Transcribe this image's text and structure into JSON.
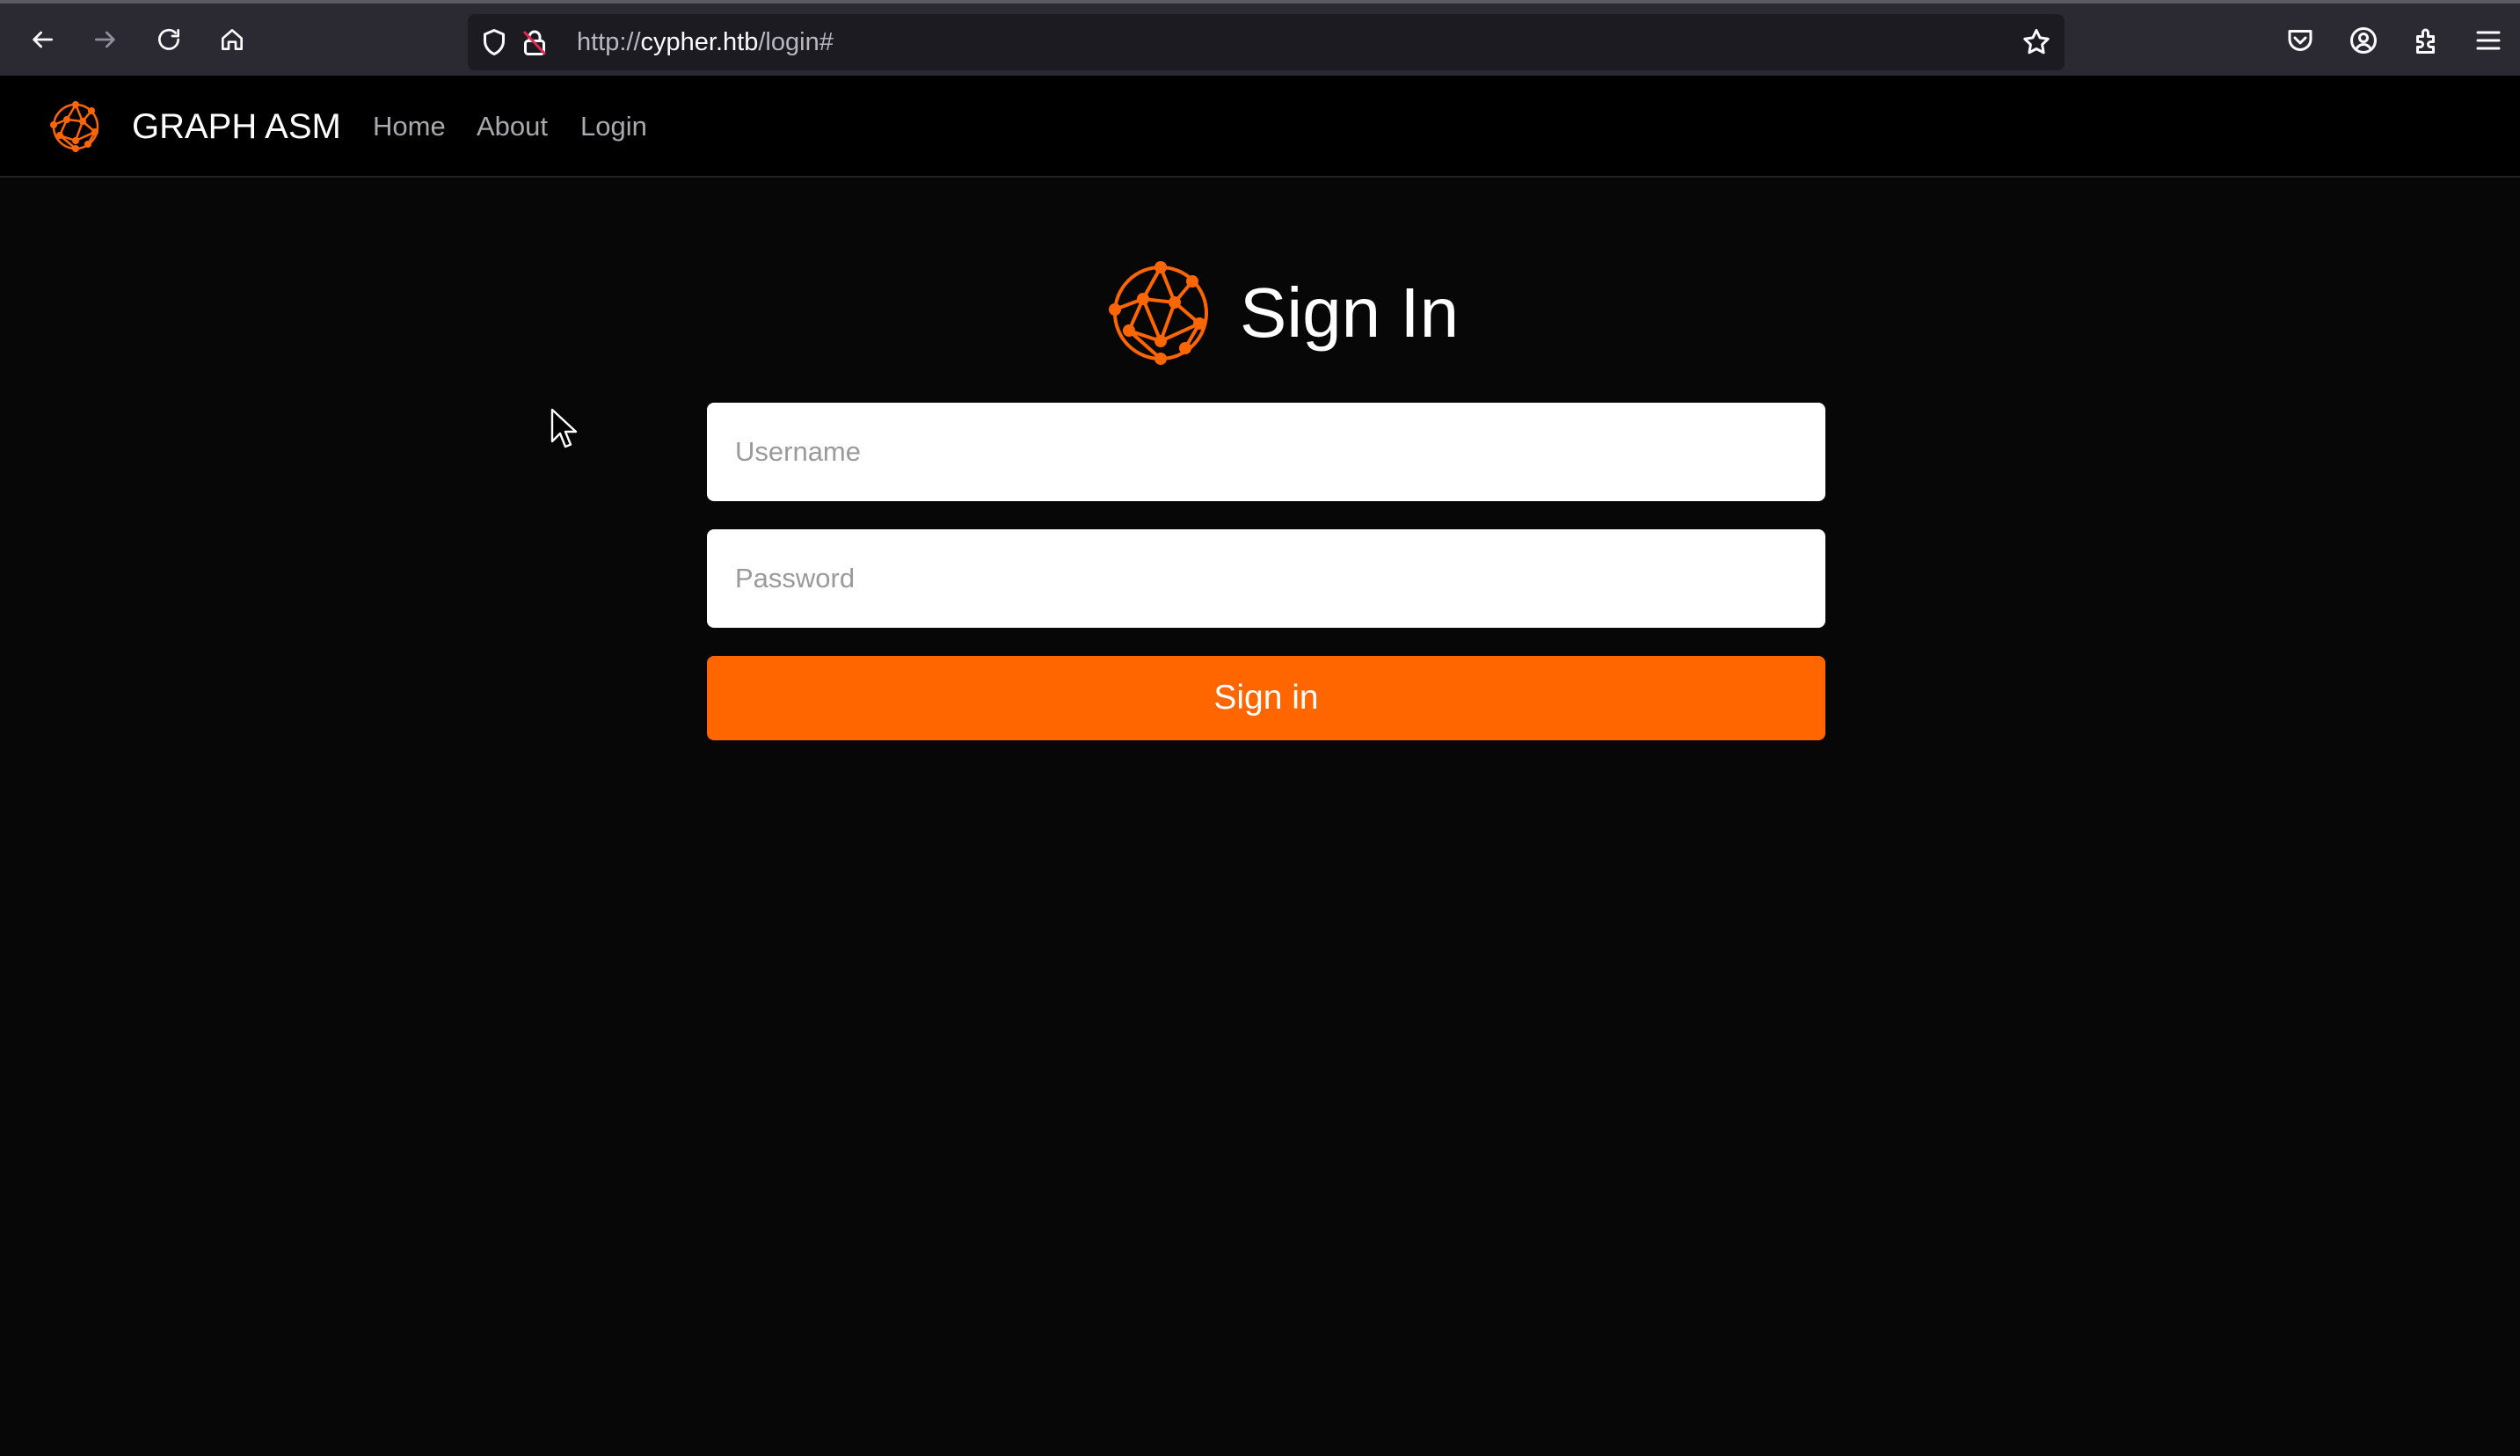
{
  "browser": {
    "url_scheme": "http://",
    "url_host": "cypher.htb",
    "url_path": "/login#",
    "icons": {
      "back": "back-arrow-icon",
      "forward": "forward-arrow-icon",
      "reload": "reload-icon",
      "home": "home-icon",
      "shield": "shield-icon",
      "lock": "lock-icon",
      "bookmark": "star-icon",
      "pocket": "pocket-icon",
      "account": "account-icon",
      "extensions": "extensions-icon",
      "menu": "hamburger-menu-icon"
    }
  },
  "site": {
    "brand": "GRAPH ASM",
    "nav": {
      "home": "Home",
      "about": "About",
      "login": "Login"
    }
  },
  "login": {
    "title": "Sign In",
    "username_placeholder": "Username",
    "password_placeholder": "Password",
    "submit_label": "Sign in"
  },
  "colors": {
    "accent": "#ff6600",
    "page_background": "#070707",
    "navbar_background": "#000000",
    "browser_chrome": "#2b2a33"
  }
}
